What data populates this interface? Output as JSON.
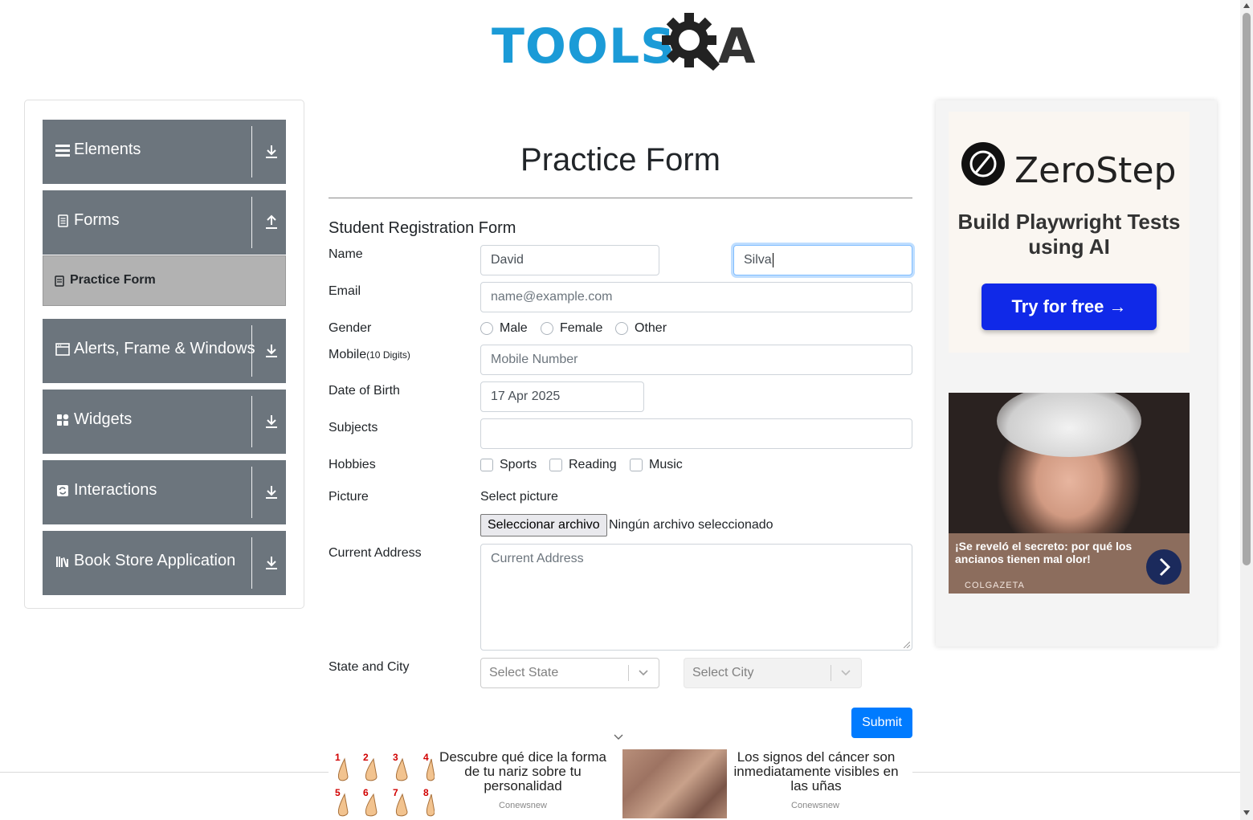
{
  "header": {
    "logo_word": "TOOLS",
    "logo_letter": "A"
  },
  "sidebar": {
    "groups": [
      {
        "label": "Elements",
        "icon": "hamburger-icon",
        "toggle": "download-icon"
      },
      {
        "label": "Forms",
        "icon": "document-icon",
        "toggle": "upload-icon"
      },
      {
        "label": "Alerts, Frame & Windows",
        "icon": "window-icon",
        "toggle": "download-icon"
      },
      {
        "label": "Widgets",
        "icon": "grid-icon",
        "toggle": "download-icon"
      },
      {
        "label": "Interactions",
        "icon": "refresh-icon",
        "toggle": "download-icon"
      },
      {
        "label": "Book Store Application",
        "icon": "books-icon",
        "toggle": "download-icon"
      }
    ],
    "active_item": "Practice Form"
  },
  "form": {
    "title": "Practice Form",
    "subtitle": "Student Registration Form",
    "labels": {
      "name": "Name",
      "email": "Email",
      "gender": "Gender",
      "mobile": "Mobile",
      "mobile_hint": "(10 Digits)",
      "dob": "Date of Birth",
      "subjects": "Subjects",
      "hobbies": "Hobbies",
      "picture": "Picture",
      "address": "Current Address",
      "state_city": "State and City"
    },
    "first_name": "David",
    "last_name": "Silva",
    "email_placeholder": "name@example.com",
    "gender_options": [
      "Male",
      "Female",
      "Other"
    ],
    "mobile_placeholder": "Mobile Number",
    "dob_value": "17 Apr 2025",
    "subjects_value": "",
    "hobby_options": [
      "Sports",
      "Reading",
      "Music"
    ],
    "picture_caption": "Select picture",
    "file_button": "Seleccionar archivo",
    "file_status": "Ningún archivo seleccionado",
    "address_placeholder": "Current Address",
    "state_placeholder": "Select State",
    "city_placeholder": "Select City",
    "submit": "Submit"
  },
  "ads": {
    "zerostep": {
      "brand": "ZeroStep",
      "tagline": "Build Playwright Tests using AI",
      "cta": "Try for free →"
    },
    "news": {
      "headline": "¡Se reveló el secreto: por qué los ancianos tienen mal olor!",
      "source": "COLGAZETA"
    },
    "bottom": [
      {
        "text": "Descubre qué dice la forma de tu nariz sobre tu personalidad",
        "source": "Conewsnew",
        "numbers": [
          "1",
          "2",
          "3",
          "4",
          "5",
          "6",
          "7",
          "8"
        ]
      },
      {
        "text": "Los signos del cáncer son inmediatamente visibles en las uñas",
        "source": "Conewsnew"
      }
    ]
  },
  "colors": {
    "primary": "#007bff",
    "sidebar_group": "#6c757d",
    "sidebar_active": "#b2b2b2",
    "logo_blue": "#1b9bd7"
  }
}
